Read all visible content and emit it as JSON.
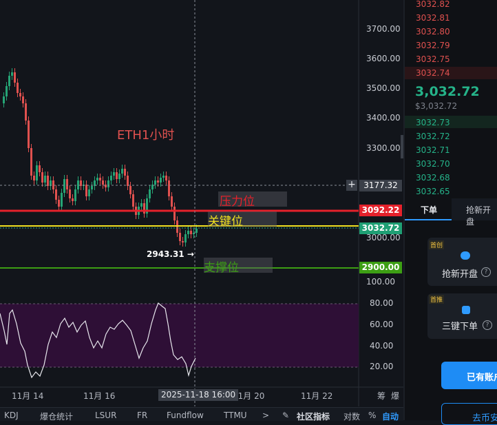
{
  "chart": {
    "title_annotation": "ETH1小时",
    "labels": {
      "resistance": "压力位",
      "key": "关键位",
      "support": "支撑位"
    },
    "low_marker": "2943.31 →",
    "y_ticks": [
      "3700.00",
      "3600.00",
      "3500.00",
      "3400.00",
      "3300.00",
      "3000.00",
      "100.00"
    ],
    "price_tags": {
      "crosshair": "3177.32",
      "resistance": "3092.22",
      "current": "3032.72",
      "support": "2900.00"
    },
    "osc_ticks": [
      "80.00",
      "60.00",
      "40.00",
      "20.00"
    ],
    "x_labels": [
      "11月 14",
      "11月 16",
      "11月 20",
      "11月 22"
    ],
    "crosshair_time": "2025-11-18 16:00",
    "corner_labels": [
      "筹",
      "爆"
    ],
    "colors": {
      "resistance": "#e5212b",
      "key": "#f0e020",
      "support": "#3d9f14",
      "up": "#25a475",
      "down": "#e0514f",
      "osc_bg": "#2e0f36"
    }
  },
  "toolbar": {
    "items": [
      "KDJ",
      "爆仓统计",
      "LSUR",
      "FR",
      "Fundflow",
      "TTMU"
    ],
    "more": ">",
    "community": "社区指标",
    "log": "对数",
    "percent": "%",
    "auto": "自动"
  },
  "orderbook": {
    "asks": [
      "3032.82",
      "3032.81",
      "3032.80",
      "3032.79",
      "3032.75",
      "3032.74"
    ],
    "last_price": "3,032.72",
    "last_price_usd": "$3,032.72",
    "bids": [
      "3032.73",
      "3032.72",
      "3032.71",
      "3032.70",
      "3032.68",
      "3032.65"
    ]
  },
  "trade": {
    "tabs": [
      "下单",
      "抢新开盘"
    ],
    "cards": [
      {
        "badge": "首创",
        "label": "抢新开盘",
        "help": "?"
      },
      {
        "badge": "首推",
        "label": "三键下单",
        "help": "?"
      }
    ],
    "account_button": "已有账户",
    "bottom_button": "去币安"
  }
}
